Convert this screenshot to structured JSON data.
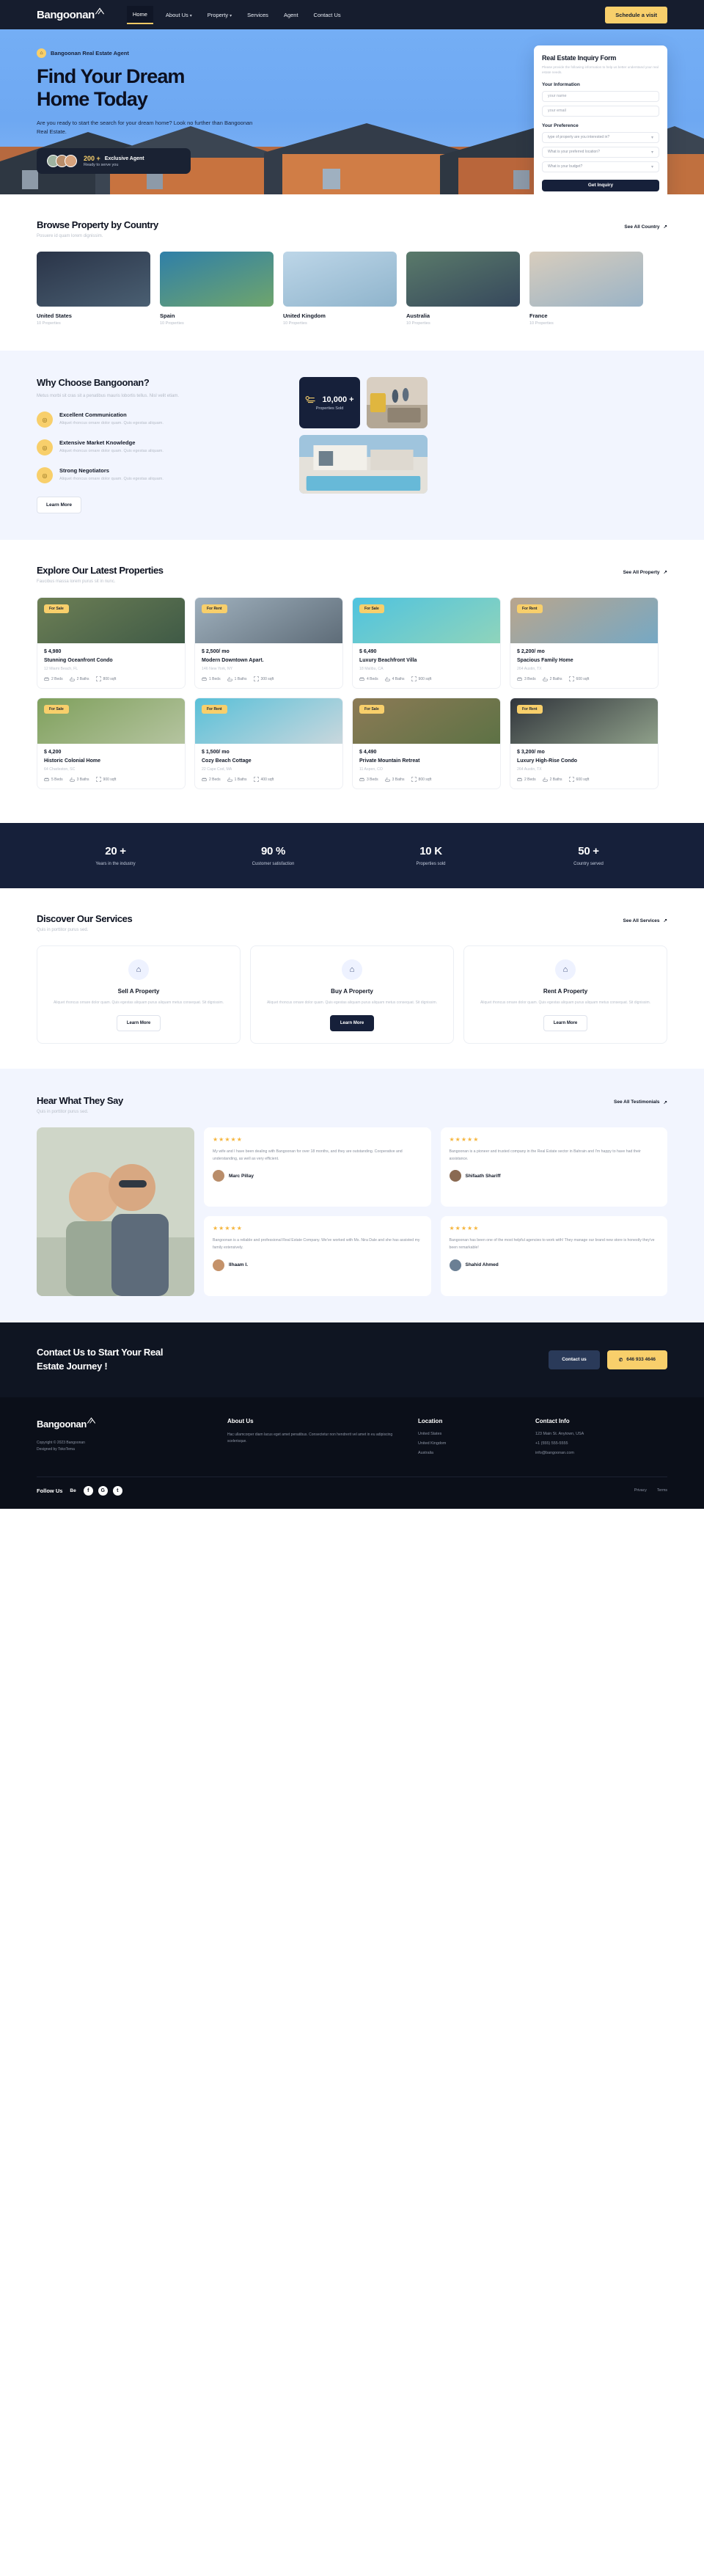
{
  "nav": {
    "brand": "Bangoonan",
    "links": [
      {
        "label": "Home",
        "active": true,
        "caret": false
      },
      {
        "label": "About Us",
        "active": false,
        "caret": true
      },
      {
        "label": "Property",
        "active": false,
        "caret": true
      },
      {
        "label": "Services",
        "active": false,
        "caret": false
      },
      {
        "label": "Agent",
        "active": false,
        "caret": false
      },
      {
        "label": "Contact Us",
        "active": false,
        "caret": false
      }
    ],
    "cta": "Schedule a visit"
  },
  "hero": {
    "eyebrow": "Bangoonan Real Estate Agent",
    "title_line1": "Find Your Dream",
    "title_line2": "Home Today",
    "description": "Are you ready to start the search for your dream home? Look no further than Bangoonan Real Estate.",
    "agent_count": "200 +",
    "agent_label": "Exclusive Agent",
    "agent_sub": "Ready to serve you"
  },
  "form": {
    "title": "Real Estate Inquiry Form",
    "subtitle": "Please provide the following information to help us better understand your real estate needs.",
    "section_info": "Your Information",
    "name_placeholder": "your name",
    "email_placeholder": "your email",
    "section_pref": "Your Preference",
    "q_type": "type of property are you interested in?",
    "q_location": "What is your preferred location?",
    "q_budget": "What is your budget?",
    "submit": "Get Inquiry"
  },
  "country_section": {
    "title": "Browse Property by Country",
    "subtitle": "Posuere id quam lorem dignissim.",
    "see_all": "See All Country",
    "items": [
      {
        "name": "United States",
        "count": "10 Properties",
        "c1": "#2a3448",
        "c2": "#4a5f72"
      },
      {
        "name": "Spain",
        "count": "10 Properties",
        "c1": "#2f7fa8",
        "c2": "#6fa56c"
      },
      {
        "name": "United Kingdom",
        "count": "10 Properties",
        "c1": "#bdd6e8",
        "c2": "#8fb4cc"
      },
      {
        "name": "Australia",
        "count": "10 Properties",
        "c1": "#5a7a6a",
        "c2": "#36485c"
      },
      {
        "name": "France",
        "count": "10 Properties",
        "c1": "#d8cdbd",
        "c2": "#9ab3c6"
      }
    ]
  },
  "why": {
    "title": "Why Choose Bangoonan?",
    "subtitle": "Metus morbi sit cras sit a penatibus mauris lobortis tellus. Nisl velit etiam.",
    "features": [
      {
        "title": "Excellent Communication",
        "desc": "Aliquet rhoncus ornare dolor quam. Quis egestas aliquam."
      },
      {
        "title": "Extensive Market Knowledge",
        "desc": "Aliquet rhoncus ornare dolor quam. Quis egestas aliquam."
      },
      {
        "title": "Strong Negotiators",
        "desc": "Aliquet rhoncus ornare dolor quam. Quis egestas aliquam."
      }
    ],
    "learn_more": "Learn More",
    "stat_number": "10,000 +",
    "stat_label": "Properties Sold"
  },
  "properties_section": {
    "title": "Explore Our Latest Properties",
    "subtitle": "Faucibus massa lorem purus sit in nunc.",
    "see_all": "See All Property",
    "items": [
      {
        "tag": "For Sale",
        "price": "$ 4,980",
        "name": "Stunning Oceanfront Condo",
        "address": "12 Miami Beach, FL",
        "beds": "2 Beds",
        "baths": "2 Baths",
        "sqft": "800 sqft",
        "c1": "#6d7f55",
        "c2": "#3f5a46"
      },
      {
        "tag": "For Rent",
        "price": "$ 2,500/ mo",
        "name": "Modern Downtown Apart.",
        "address": "146 New York, NY",
        "beds": "1 Beds",
        "baths": "1 Baths",
        "sqft": "300 sqft",
        "c1": "#9fb0bd",
        "c2": "#5e6c78"
      },
      {
        "tag": "For Sale",
        "price": "$ 6,490",
        "name": "Luxury Beachfront Villa",
        "address": "18 Malibu, CA",
        "beds": "4 Beds",
        "baths": "4 Baths",
        "sqft": "900 sqft",
        "c1": "#4fc3df",
        "c2": "#8fd4bb"
      },
      {
        "tag": "For Rent",
        "price": "$ 2,200/ mo",
        "name": "Spacious Family Home",
        "address": "264 Austin, TX",
        "beds": "3 Beds",
        "baths": "2 Baths",
        "sqft": "600 sqft",
        "c1": "#b9a58d",
        "c2": "#76a8c4"
      },
      {
        "tag": "For Sale",
        "price": "$ 4,200",
        "name": "Historic Colonial Home",
        "address": "64 Charleston, SC",
        "beds": "5 Beds",
        "baths": "3 Baths",
        "sqft": "900 sqft",
        "c1": "#7fa05c",
        "c2": "#b5c4a0"
      },
      {
        "tag": "For Rent",
        "price": "$ 1,500/ mo",
        "name": "Cozy Beach Cottage",
        "address": "22 Cape Cod, MA",
        "beds": "2 Beds",
        "baths": "1 Baths",
        "sqft": "400 sqft",
        "c1": "#59c0d8",
        "c2": "#c9d7dd"
      },
      {
        "tag": "For Sale",
        "price": "$ 4,490",
        "name": "Private Mountain Retreat",
        "address": "11 Aspen, CO",
        "beds": "3 Beds",
        "baths": "3 Baths",
        "sqft": "800 sqft",
        "c1": "#8c7a55",
        "c2": "#5d7245"
      },
      {
        "tag": "For Rent",
        "price": "$ 3,200/ mo",
        "name": "Luxury High-Rise Condo",
        "address": "264 Austin, TX",
        "beds": "2 Beds",
        "baths": "2 Baths",
        "sqft": "600 sqft",
        "c1": "#30343b",
        "c2": "#8fa08a"
      }
    ]
  },
  "stats": [
    {
      "number": "20 +",
      "label": "Years in the industry"
    },
    {
      "number": "90 %",
      "label": "Customer satisfaction"
    },
    {
      "number": "10 K",
      "label": "Properties sold"
    },
    {
      "number": "50 +",
      "label": "Country served"
    }
  ],
  "services_section": {
    "title": "Discover Our Services",
    "subtitle": "Quis in porttitor purus sed.",
    "see_all": "See All Services",
    "items": [
      {
        "icon": "sell-home-icon",
        "title": "Sell A Property",
        "desc": "Aliquet rhoncus ornare dolor quam. Quis egestas aliquam purus aliquam metus consequat. Sit dignissim.",
        "button": "Learn More",
        "dark": false
      },
      {
        "icon": "buy-home-icon",
        "title": "Buy A Property",
        "desc": "Aliquet rhoncus ornare dolor quam. Quis egestas aliquam purus aliquam metus consequat. Sit dignissim.",
        "button": "Learn More",
        "dark": true
      },
      {
        "icon": "rent-home-icon",
        "title": "Rent A Property",
        "desc": "Aliquet rhoncus ornare dolor quam. Quis egestas aliquam purus aliquam metus consequat. Sit dignissim.",
        "button": "Learn More",
        "dark": false
      }
    ]
  },
  "testimonials_section": {
    "title": "Hear What They Say",
    "subtitle": "Quis in porttitor purus sed.",
    "see_all": "See All Testimonials",
    "items": [
      {
        "stars": "★★★★★",
        "text": "My wife and I have been dealing with Bangoonan for over 18 months, and they are outstanding. Cooperative and understanding, as well as very efficient.",
        "name": "Marc Pillay",
        "avatar": "#b98d6a"
      },
      {
        "stars": "★★★★★",
        "text": "Bangoonan is a pioneer and trusted company in the Real Estate sector in Bahrain and I'm happy to have had their assistance.",
        "name": "Shifaath Shariff",
        "avatar": "#8a6a52"
      },
      {
        "stars": "★★★★★",
        "text": "Bangoonan is a reliable and professional Real Estate Company. We've worked with Ms. Nira Dale and she has assisted my family extensively.",
        "name": "Ilhaam I.",
        "avatar": "#c4926a"
      },
      {
        "stars": "★★★★★",
        "text": "Bangoonan has been one of the most helpful agencies to work with! They manage our brand new store is honestly they've been remarkable!",
        "name": "Shahid Ahmed",
        "avatar": "#6b7f94"
      }
    ]
  },
  "cta": {
    "line1": "Contact Us to Start Your Real",
    "line2": "Estate Journey !",
    "button1": "Contact us",
    "button2": "646 933 4646",
    "phone_icon": "phone-icon"
  },
  "footer": {
    "brand": "Bangoonan",
    "copyright": "Copyright © 2023 Bangoonan",
    "designed": "Designed by TokoTema",
    "about_title": "About Us",
    "about_text": "Hac ullamcorper diam lacus eget amet penatibus. Consectetur non hendrerit vel amet in eu adipiscing scelerisque.",
    "location_title": "Location",
    "locations": [
      "United States",
      "United Kingdom",
      "Australia"
    ],
    "contact_title": "Contact Info",
    "contact": [
      "123 Main St. Anytown, USA",
      "+1 (555) 555-5555",
      "info@bangoonan.com"
    ],
    "follow": "Follow Us",
    "behance": "Be",
    "socials": [
      "f",
      "G",
      "t"
    ],
    "legal": [
      "Privacy",
      "Terms"
    ]
  }
}
